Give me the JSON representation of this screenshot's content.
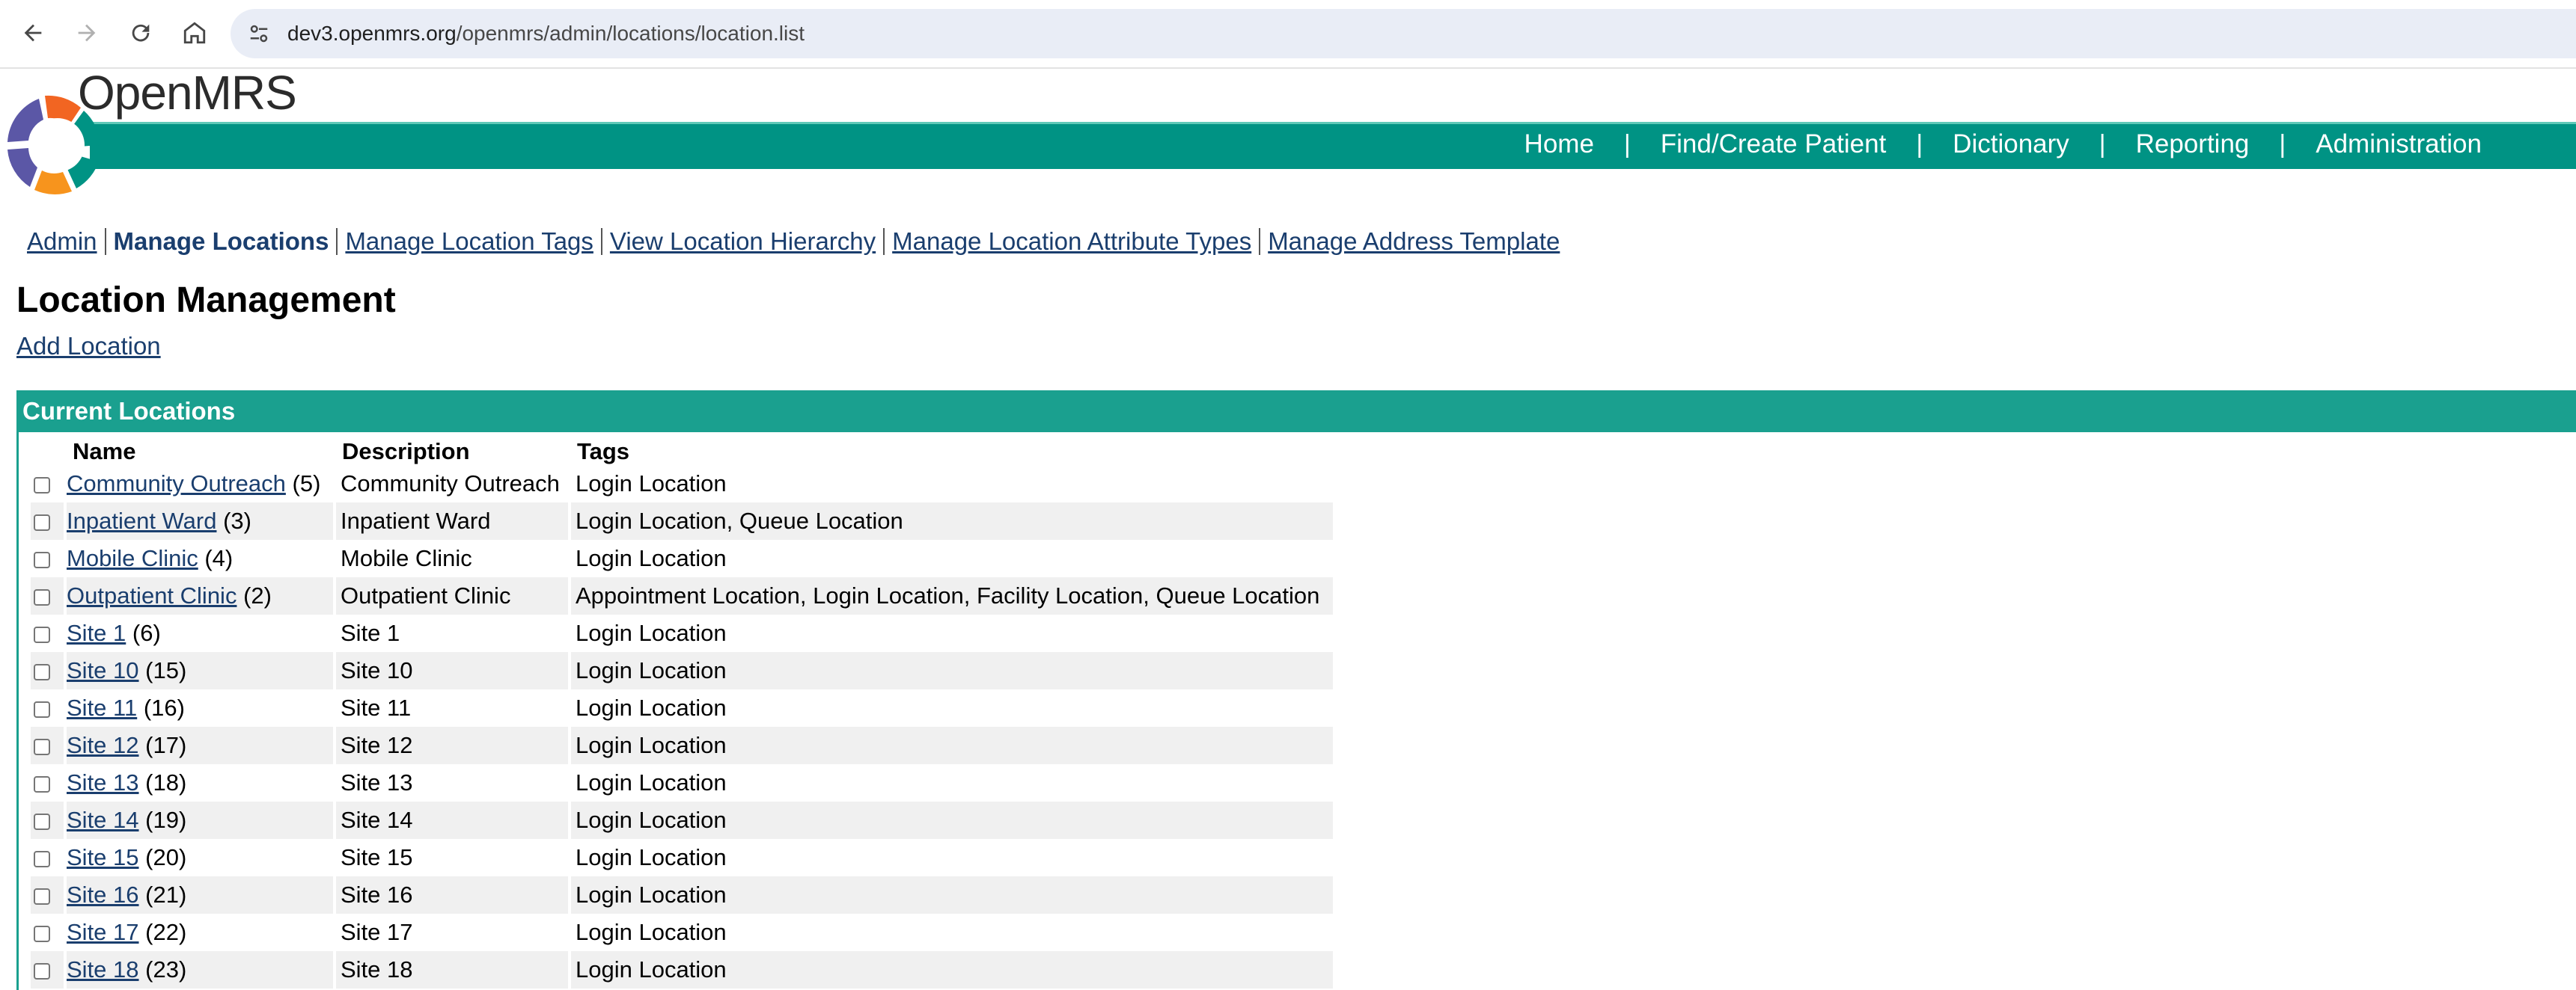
{
  "browser": {
    "url_host": "dev3.openmrs.org",
    "url_path": "/openmrs/admin/locations/location.list"
  },
  "header": {
    "logo_text": "OpenMRS",
    "nav": [
      "Home",
      "Find/Create Patient",
      "Dictionary",
      "Reporting",
      "Administration"
    ]
  },
  "subnav": {
    "items": [
      "Admin",
      "Manage Locations",
      "Manage Location Tags",
      "View Location Hierarchy",
      "Manage Location Attribute Types",
      "Manage Address Template"
    ]
  },
  "page": {
    "title": "Location Management",
    "add_link": "Add Location"
  },
  "box": {
    "title": "Current Locations",
    "columns": [
      "Name",
      "Description",
      "Tags"
    ],
    "rows": [
      {
        "name": "Community Outreach",
        "id": "(5)",
        "description": "Community Outreach",
        "tags": "Login Location"
      },
      {
        "name": "Inpatient Ward",
        "id": "(3)",
        "description": "Inpatient Ward",
        "tags": "Login Location, Queue Location"
      },
      {
        "name": "Mobile Clinic",
        "id": "(4)",
        "description": "Mobile Clinic",
        "tags": "Login Location"
      },
      {
        "name": "Outpatient Clinic",
        "id": "(2)",
        "description": "Outpatient Clinic",
        "tags": "Appointment Location, Login Location, Facility Location, Queue Location"
      },
      {
        "name": "Site 1",
        "id": "(6)",
        "description": "Site 1",
        "tags": "Login Location"
      },
      {
        "name": "Site 10",
        "id": "(15)",
        "description": "Site 10",
        "tags": "Login Location"
      },
      {
        "name": "Site 11",
        "id": "(16)",
        "description": "Site 11",
        "tags": "Login Location"
      },
      {
        "name": "Site 12",
        "id": "(17)",
        "description": "Site 12",
        "tags": "Login Location"
      },
      {
        "name": "Site 13",
        "id": "(18)",
        "description": "Site 13",
        "tags": "Login Location"
      },
      {
        "name": "Site 14",
        "id": "(19)",
        "description": "Site 14",
        "tags": "Login Location"
      },
      {
        "name": "Site 15",
        "id": "(20)",
        "description": "Site 15",
        "tags": "Login Location"
      },
      {
        "name": "Site 16",
        "id": "(21)",
        "description": "Site 16",
        "tags": "Login Location"
      },
      {
        "name": "Site 17",
        "id": "(22)",
        "description": "Site 17",
        "tags": "Login Location"
      },
      {
        "name": "Site 18",
        "id": "(23)",
        "description": "Site 18",
        "tags": "Login Location"
      }
    ]
  },
  "colors": {
    "banner": "#009384",
    "box_header": "#1aa08f",
    "link": "#1a3e6e",
    "row_alt": "#f0f0f0"
  }
}
